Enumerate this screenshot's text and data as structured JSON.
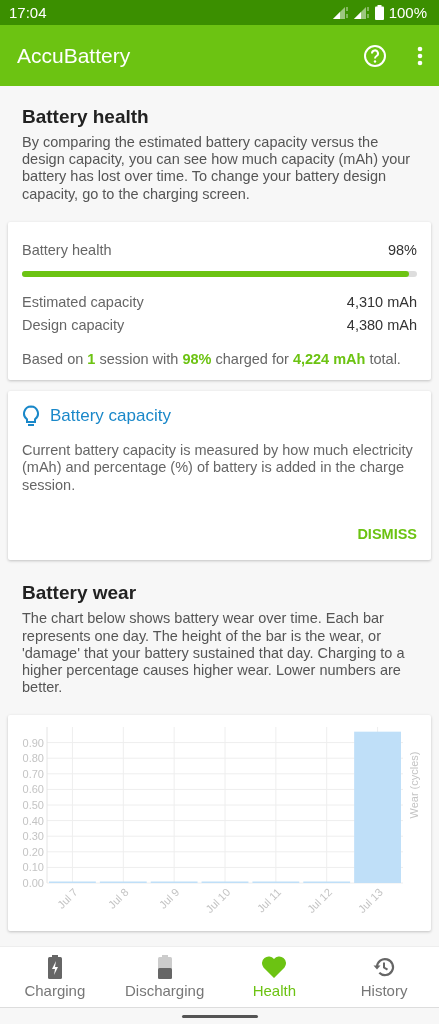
{
  "status_bar": {
    "time": "17:04",
    "battery": "100%"
  },
  "app_bar": {
    "title": "AccuBattery"
  },
  "health_section": {
    "title": "Battery health",
    "description": "By comparing the estimated battery capacity versus the design capacity, you can see how much capacity (mAh) your battery has lost over time. To change your battery design capacity, go to the charging screen."
  },
  "health_card": {
    "label": "Battery health",
    "value": "98%",
    "level": 0.98,
    "rows": [
      {
        "label": "Estimated capacity",
        "value": "4,310 mAh"
      },
      {
        "label": "Design capacity",
        "value": "4,380 mAh"
      }
    ],
    "summary": "Based on **1** session with **98%** charged for **4,224 mAh** total."
  },
  "tip_card": {
    "title": "Battery capacity",
    "text": "Current battery capacity is measured by how much electricity (mAh) and percentage (%) of battery is added in the charge session.",
    "button": "DISMISS"
  },
  "wear_section": {
    "title": "Battery wear",
    "description": "The chart below shows battery wear over time. Each bar represents one day. The height of the bar is the wear, or 'damage' that your battery sustained that day. Charging to a higher percentage causes higher wear. Lower numbers are better."
  },
  "wear_chart": {
    "chart_data": {
      "type": "bar",
      "ylabel": "Wear (cycles)",
      "categories": [
        "Jul 7",
        "Jul 8",
        "Jul 9",
        "Jul 10",
        "Jul 11",
        "Jul 12",
        "Jul 13"
      ],
      "values": [
        0,
        0,
        0,
        0,
        0,
        0,
        0.97
      ],
      "ylim": [
        0,
        1
      ],
      "grid": true,
      "yticks": [
        {
          "value": 0,
          "label": "0.00"
        },
        {
          "value": 0.1,
          "label": "0.10"
        },
        {
          "value": 0.2,
          "label": "0.20"
        },
        {
          "value": 0.3,
          "label": "0.30"
        },
        {
          "value": 0.4,
          "label": "0.40"
        },
        {
          "value": 0.5,
          "label": "0.50"
        },
        {
          "value": 0.6,
          "label": "0.60"
        },
        {
          "value": 0.7,
          "label": "0.70"
        },
        {
          "value": 0.8,
          "label": "0.80"
        },
        {
          "value": 0.9,
          "label": "0.90"
        }
      ]
    }
  },
  "bottom_nav": [
    {
      "label": "Charging",
      "selected": false
    },
    {
      "label": "Discharging",
      "selected": false
    },
    {
      "label": "Health",
      "selected": true
    },
    {
      "label": "History",
      "selected": false
    }
  ]
}
